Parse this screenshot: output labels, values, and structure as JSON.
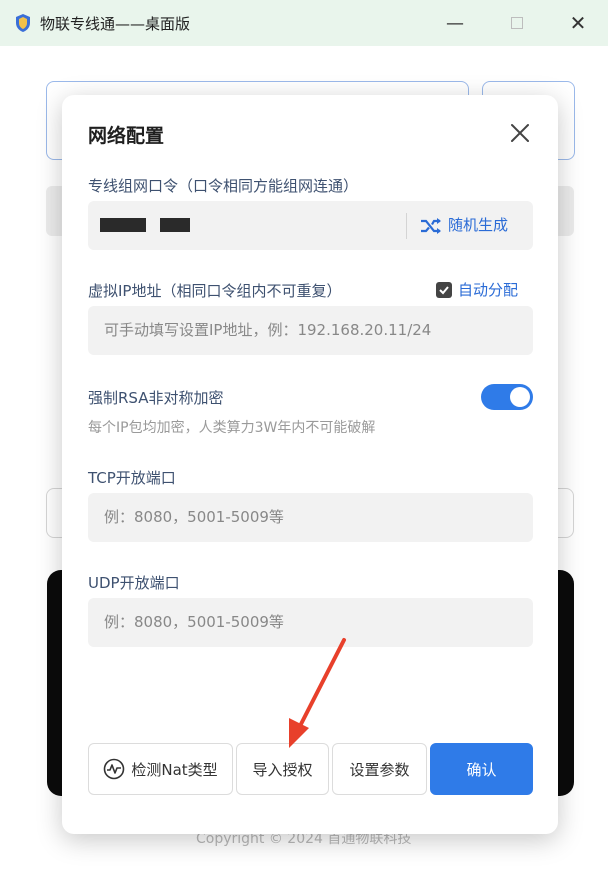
{
  "window": {
    "title": "物联专线通——桌面版",
    "minimize_icon": "—",
    "maximize_icon": "☐",
    "close_icon": "✕"
  },
  "background": {
    "copyright": "Copyright © 2024 首通物联科技"
  },
  "modal": {
    "title": "网络配置",
    "group_password": {
      "label": "专线组网口令（口令相同方能组网连通）",
      "random_button": "随机生成"
    },
    "virtual_ip": {
      "label": "虚拟IP地址（相同口令组内不可重复）",
      "auto_assign_label": "自动分配",
      "auto_assign_checked": true,
      "placeholder": "可手动填写设置IP地址，例：192.168.20.11/24"
    },
    "rsa": {
      "label": "强制RSA非对称加密",
      "hint": "每个IP包均加密，人类算力3W年内不可能破解",
      "enabled": true
    },
    "tcp": {
      "label": "TCP开放端口",
      "placeholder": "例：8080，5001-5009等"
    },
    "udp": {
      "label": "UDP开放端口",
      "placeholder": "例：8080，5001-5009等"
    },
    "buttons": {
      "detect_nat": "检测Nat类型",
      "import_license": "导入授权",
      "settings": "设置参数",
      "confirm": "确认"
    }
  },
  "colors": {
    "accent": "#2f7be8",
    "link": "#2a6bd6",
    "annotation_arrow": "#e8402b"
  }
}
